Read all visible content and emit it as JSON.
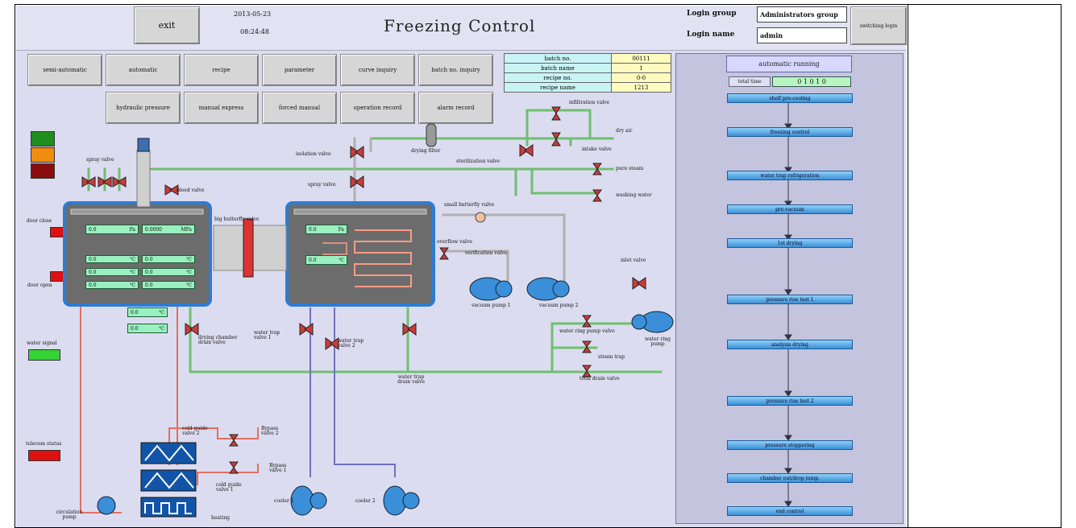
{
  "header": {
    "exit_label": "exit",
    "date": "2013-05-23",
    "time": "08:24:48",
    "title": "Freezing Control",
    "login_group_label": "Login group",
    "login_group_value": "Administrators group",
    "login_name_label": "Login name",
    "login_name_value": "admin",
    "switch_label": "switching login"
  },
  "nav": {
    "row1": [
      "semi-automatic",
      "automatic",
      "recipe",
      "parameter",
      "curve inquiry",
      "batch no. inquiry"
    ],
    "row2": [
      "hydraulic pressure",
      "manual express",
      "forced manual",
      "operation record",
      "alarm record"
    ]
  },
  "batch_info": [
    {
      "key": "batch no.",
      "value": "00111"
    },
    {
      "key": "batch name",
      "value": "1"
    },
    {
      "key": "recipe no.",
      "value": "0-0"
    },
    {
      "key": "recipe name",
      "value": "1213"
    }
  ],
  "sequence": {
    "status": "automatic running",
    "total_time_label": "total time",
    "total_time_value": "0 1 0 1 0",
    "steps": [
      "shelf pre-cooling",
      "freezing control",
      "water trap refrigeration",
      "pre-vacuum",
      "1st drying",
      "pressure rise test 1",
      "analysis drying",
      "pressure rise test 2",
      "pressure stoppering",
      "chamber out/drop temp.",
      "end control"
    ]
  },
  "status_panel": {
    "door_close": "door close",
    "door_open": "door open",
    "water_signal": "water signal",
    "telecom_status": "telecom status"
  },
  "readouts": {
    "chamber_pa": "0.0",
    "chamber_pa_unit": "Pa",
    "chamber_mpa": "0.0000",
    "chamber_mpa_unit": "MPa",
    "c1a": "0.0",
    "c1b": "0.0",
    "c2a": "0.0",
    "c2b": "0.0",
    "c3a": "0.0",
    "c3b": "0.0",
    "temp_unit": "℃",
    "ext1": "0.0",
    "ext2": "0.0",
    "cond_pa": "0.0",
    "cond_pa_unit": "Pa",
    "cond_temp": "0.0"
  },
  "labels": {
    "spray_valve": "spray valve",
    "bleed_valve": "bleed valve",
    "big_butterfly_valve": "big butterfly valve",
    "isolation_valve": "isolation valve",
    "spray_valve_2": "spray valve",
    "drying_filter": "drying filter",
    "sterilization_valve": "sterilization valve",
    "infiltration_valve": "infiltration valve",
    "dry_air": "dry air",
    "intake_valve": "intake valve",
    "pure_steam": "pure steam",
    "washing_water": "washing water",
    "small_butterfly_valve": "small butterfly valve",
    "overflow_valve": "overflow valve",
    "verification_valve": "verification valve",
    "vacuum_pump_1": "vacuum pump 1",
    "vacuum_pump_2": "vacuum pump 2",
    "inlet_valve": "inlet valve",
    "water_ring_pump_valve": "water ring pump valve",
    "water_ring_pump": "water ring pump",
    "steam_trap": "steam trap",
    "total_drain_valve": "total drain valve",
    "drying_chamber_drain_valve": "drying chamber drain valve",
    "water_trap_valve_1": "water trap valve 1",
    "water_trap_valve_2": "water trap valve 2",
    "water_trap_drain_valve": "water trap drain valve",
    "cold_guide_valve_2": "cold guide valve 2",
    "bypass_valve_2": "Bypass valve 2",
    "bypass_valve_1": "Bypass valve 1",
    "cold_guide_valve_1": "cold guide valve 1",
    "cooler_1": "cooler 1",
    "cooler_2": "cooler 2",
    "circulation_pump": "circulation pump",
    "heating": "heating"
  },
  "colors": {
    "pipe_green": "#6fbf6f",
    "pipe_gray": "#b0b0b0",
    "pipe_red": "#e07060",
    "pipe_blue": "#7070b8",
    "vessel_border": "#2b7cd6",
    "lcd": "#9af0c0",
    "step": "#4aa3e8"
  }
}
